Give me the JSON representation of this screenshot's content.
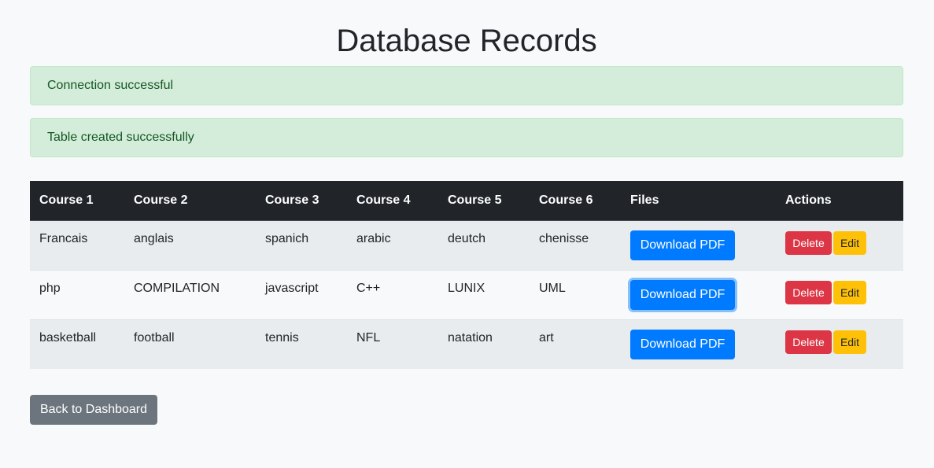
{
  "page": {
    "title": "Database Records"
  },
  "alerts": [
    {
      "text": "Connection successful"
    },
    {
      "text": "Table created successfully"
    }
  ],
  "table": {
    "headers": [
      "Course 1",
      "Course 2",
      "Course 3",
      "Course 4",
      "Course 5",
      "Course 6",
      "Files",
      "Actions"
    ],
    "rows": [
      {
        "c1": "Francais",
        "c2": "anglais",
        "c3": "spanich",
        "c4": "arabic",
        "c5": "deutch",
        "c6": "chenisse"
      },
      {
        "c1": "php",
        "c2": "COMPILATION",
        "c3": "javascript",
        "c4": "C++",
        "c5": "LUNIX",
        "c6": "UML"
      },
      {
        "c1": "basketball",
        "c2": "football",
        "c3": "tennis",
        "c4": "NFL",
        "c5": "natation",
        "c6": "art"
      }
    ],
    "download_label": "Download PDF",
    "delete_label": "Delete",
    "edit_label": "Edit"
  },
  "footer": {
    "back_label": "Back to Dashboard"
  },
  "colors": {
    "primary": "#007bff",
    "danger": "#dc3545",
    "warning": "#ffc107",
    "secondary": "#6c757d",
    "success_bg": "#d4edda",
    "dark": "#212529"
  }
}
